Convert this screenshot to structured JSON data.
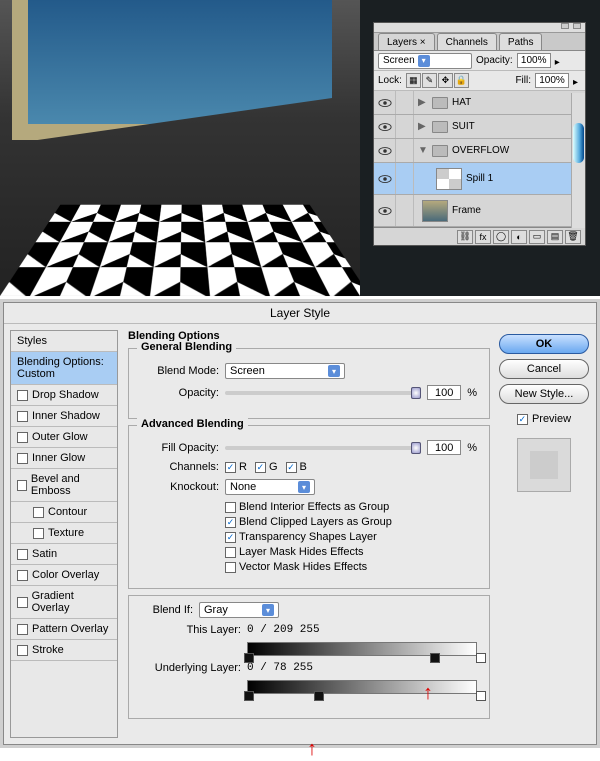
{
  "layers_panel": {
    "tabs": [
      "Layers",
      "Channels",
      "Paths"
    ],
    "active_tab": "Layers",
    "blend_mode": "Screen",
    "opacity_label": "Opacity:",
    "opacity_value": "100%",
    "lock_label": "Lock:",
    "fill_label": "Fill:",
    "fill_value": "100%",
    "layers": [
      {
        "name": "HAT",
        "type": "group",
        "expanded": false
      },
      {
        "name": "SUIT",
        "type": "group",
        "expanded": false
      },
      {
        "name": "OVERFLOW",
        "type": "group",
        "expanded": true
      },
      {
        "name": "Spill 1",
        "type": "layer",
        "selected": true
      },
      {
        "name": "Frame",
        "type": "layer",
        "selected": false
      }
    ],
    "footer_icons": [
      "link",
      "fx",
      "mask",
      "adj",
      "group",
      "new",
      "trash"
    ]
  },
  "layer_style": {
    "title": "Layer Style",
    "side_header": "Styles",
    "side_items": [
      {
        "label": "Blending Options: Custom",
        "selected": true,
        "checkbox": false
      },
      {
        "label": "Drop Shadow",
        "checkbox": true
      },
      {
        "label": "Inner Shadow",
        "checkbox": true
      },
      {
        "label": "Outer Glow",
        "checkbox": true
      },
      {
        "label": "Inner Glow",
        "checkbox": true
      },
      {
        "label": "Bevel and Emboss",
        "checkbox": true
      },
      {
        "label": "Contour",
        "checkbox": true,
        "indent": true
      },
      {
        "label": "Texture",
        "checkbox": true,
        "indent": true
      },
      {
        "label": "Satin",
        "checkbox": true
      },
      {
        "label": "Color Overlay",
        "checkbox": true
      },
      {
        "label": "Gradient Overlay",
        "checkbox": true
      },
      {
        "label": "Pattern Overlay",
        "checkbox": true
      },
      {
        "label": "Stroke",
        "checkbox": true
      }
    ],
    "main_heading": "Blending Options",
    "general": {
      "legend": "General Blending",
      "blend_mode_label": "Blend Mode:",
      "blend_mode": "Screen",
      "opacity_label": "Opacity:",
      "opacity": "100",
      "pct": "%"
    },
    "advanced": {
      "legend": "Advanced Blending",
      "fill_opacity_label": "Fill Opacity:",
      "fill_opacity": "100",
      "pct": "%",
      "channels_label": "Channels:",
      "channels": [
        "R",
        "G",
        "B"
      ],
      "knockout_label": "Knockout:",
      "knockout": "None",
      "opts": [
        {
          "label": "Blend Interior Effects as Group",
          "checked": false
        },
        {
          "label": "Blend Clipped Layers as Group",
          "checked": true
        },
        {
          "label": "Transparency Shapes Layer",
          "checked": true
        },
        {
          "label": "Layer Mask Hides Effects",
          "checked": false
        },
        {
          "label": "Vector Mask Hides Effects",
          "checked": false
        }
      ]
    },
    "blend_if": {
      "label": "Blend If:",
      "channel": "Gray",
      "this_layer_label": "This Layer:",
      "this_vals": "0   /   209        255",
      "under_label": "Underlying Layer:",
      "under_vals": "0   /   78        255"
    },
    "buttons": {
      "ok": "OK",
      "cancel": "Cancel",
      "new_style": "New Style..."
    },
    "preview_label": "Preview"
  }
}
